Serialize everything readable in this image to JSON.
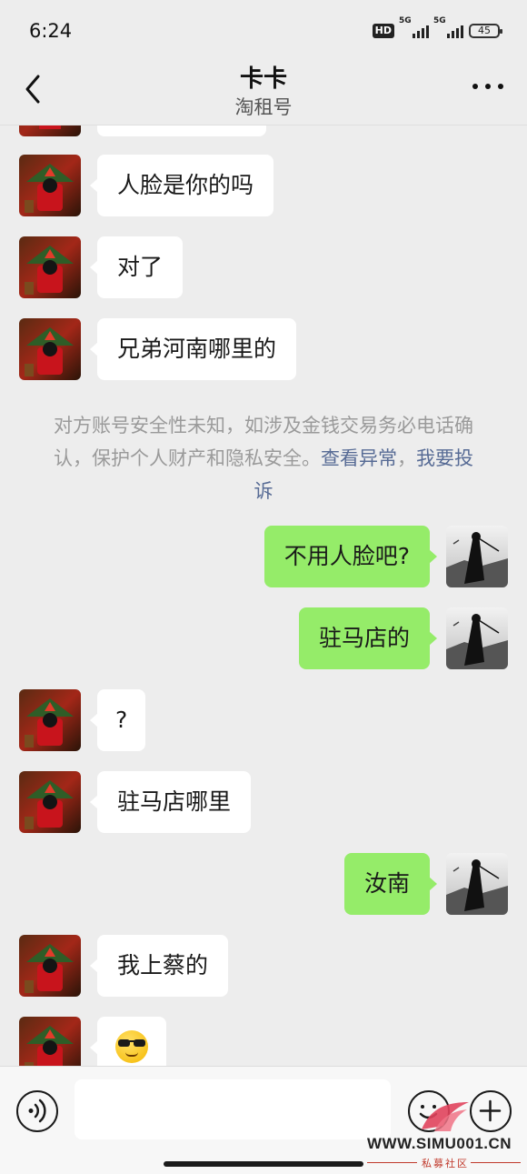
{
  "status_bar": {
    "time": "6:24",
    "hd_label": "HD",
    "signal1_label": "5G",
    "signal2_label": "5G",
    "battery": "45"
  },
  "header": {
    "title": "卡卡",
    "subtitle": "淘租号"
  },
  "messages": [
    {
      "side": "in",
      "text": "人脸是你的吗"
    },
    {
      "side": "in",
      "text": "对了"
    },
    {
      "side": "in",
      "text": "兄弟河南哪里的"
    },
    {
      "side": "out",
      "text": "不用人脸吧?"
    },
    {
      "side": "out",
      "text": "驻马店的"
    },
    {
      "side": "in",
      "text": "?"
    },
    {
      "side": "in",
      "text": "驻马店哪里"
    },
    {
      "side": "out",
      "text": "汝南"
    },
    {
      "side": "in",
      "text": "我上蔡的"
    },
    {
      "side": "in",
      "emoji": "cool-sunglasses-emoji"
    }
  ],
  "notice": {
    "text": "对方账号安全性未知，如涉及金钱交易务必电话确认，保护个人财产和隐私安全。",
    "link1": "查看异常",
    "separator": "，",
    "link2": "我要投诉"
  },
  "input_bar": {
    "voice_icon": "voice-icon",
    "emoji_icon": "emoji-icon",
    "plus_icon": "plus-icon"
  },
  "watermark": {
    "url": "WWW.SIMU001.CN",
    "sub": "私募社区"
  },
  "colors": {
    "background": "#ededed",
    "incoming_bubble": "#ffffff",
    "outgoing_bubble": "#95ec69",
    "link": "#576b95",
    "notice_text": "#9a9a9a"
  }
}
